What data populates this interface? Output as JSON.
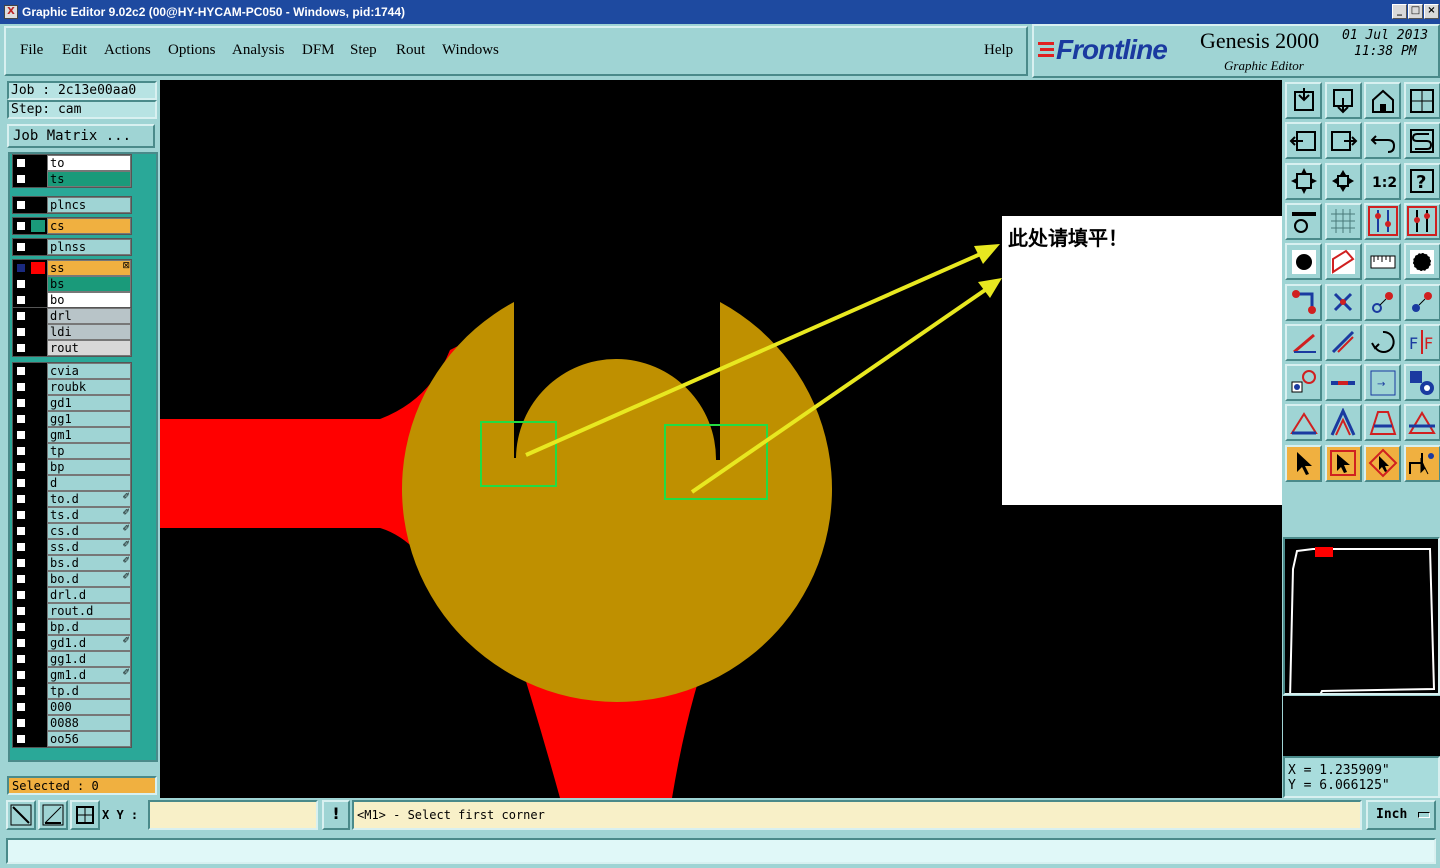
{
  "window": {
    "title": "Graphic Editor 9.02c2 (00@HY-HYCAM-PC050 - Windows, pid:1744)",
    "app_icon": "X",
    "controls": [
      "_",
      "□",
      "×"
    ]
  },
  "menu": [
    "File",
    "Edit",
    "Actions",
    "Options",
    "Analysis",
    "DFM",
    "Step",
    "Rout",
    "Windows"
  ],
  "help_label": "Help",
  "brand": {
    "logo": "Frontline",
    "product": "Genesis 2000",
    "subtitle": "Graphic Editor",
    "date": "01 Jul 2013",
    "time": "11:38 PM"
  },
  "job": {
    "job_line": "Job : 2c13e00aa0",
    "step_line": "Step: cam",
    "matrix_button": "Job Matrix ..."
  },
  "layers": [
    {
      "name": "to",
      "color": "#ffffff",
      "flag": ""
    },
    {
      "name": "ts",
      "color": "#1a9a7a",
      "flag": ""
    },
    {
      "name": "plncs",
      "color": "#9fd4d4",
      "flag": ""
    },
    {
      "name": "cs",
      "color": "#f0b040",
      "flag": ""
    },
    {
      "name": "plnss",
      "color": "#9fd4d4",
      "flag": ""
    },
    {
      "name": "ss",
      "color": "#f0b040",
      "flag": "⊠"
    },
    {
      "name": "bs",
      "color": "#1a9a7a",
      "flag": ""
    },
    {
      "name": "bo",
      "color": "#ffffff",
      "flag": ""
    },
    {
      "name": "drl",
      "color": "#b8c4c8",
      "flag": ""
    },
    {
      "name": "ldi",
      "color": "#b8c4c8",
      "flag": ""
    },
    {
      "name": "rout",
      "color": "#d8d8d8",
      "flag": ""
    },
    {
      "name": "cvia",
      "color": "#9fd4d4",
      "flag": ""
    },
    {
      "name": "roubk",
      "color": "#9fd4d4",
      "flag": ""
    },
    {
      "name": "gd1",
      "color": "#9fd4d4",
      "flag": ""
    },
    {
      "name": "gg1",
      "color": "#9fd4d4",
      "flag": ""
    },
    {
      "name": "gm1",
      "color": "#9fd4d4",
      "flag": ""
    },
    {
      "name": "tp",
      "color": "#9fd4d4",
      "flag": ""
    },
    {
      "name": "bp",
      "color": "#9fd4d4",
      "flag": ""
    },
    {
      "name": "d",
      "color": "#9fd4d4",
      "flag": ""
    },
    {
      "name": "to.d",
      "color": "#9fd4d4",
      "flag": "✐"
    },
    {
      "name": "ts.d",
      "color": "#9fd4d4",
      "flag": "✐"
    },
    {
      "name": "cs.d",
      "color": "#9fd4d4",
      "flag": "✐"
    },
    {
      "name": "ss.d",
      "color": "#9fd4d4",
      "flag": "✐"
    },
    {
      "name": "bs.d",
      "color": "#9fd4d4",
      "flag": "✐"
    },
    {
      "name": "bo.d",
      "color": "#9fd4d4",
      "flag": "✐"
    },
    {
      "name": "drl.d",
      "color": "#9fd4d4",
      "flag": ""
    },
    {
      "name": "rout.d",
      "color": "#9fd4d4",
      "flag": ""
    },
    {
      "name": "bp.d",
      "color": "#9fd4d4",
      "flag": ""
    },
    {
      "name": "gd1.d",
      "color": "#9fd4d4",
      "flag": "✐"
    },
    {
      "name": "gg1.d",
      "color": "#9fd4d4",
      "flag": ""
    },
    {
      "name": "gm1.d",
      "color": "#9fd4d4",
      "flag": "✐"
    },
    {
      "name": "tp.d",
      "color": "#9fd4d4",
      "flag": ""
    },
    {
      "name": "000",
      "color": "#9fd4d4",
      "flag": ""
    },
    {
      "name": "0088",
      "color": "#9fd4d4",
      "flag": ""
    },
    {
      "name": "oo56",
      "color": "#9fd4d4",
      "flag": ""
    }
  ],
  "selected_text": "Selected : 0",
  "annotation": "此处请填平！",
  "coords": {
    "x": "X = 1.235909\"",
    "y": "Y = 6.066125\""
  },
  "bottom": {
    "xy_label": "X Y :",
    "xy_value": "",
    "prompt": "<M1> - Select first corner",
    "units": "Inch"
  },
  "colors": {
    "copper": "#bf9000",
    "trace": "#ff0000",
    "highlight": "#22dd44",
    "arrow": "#e8e820",
    "panel": "#9fd4d4"
  }
}
